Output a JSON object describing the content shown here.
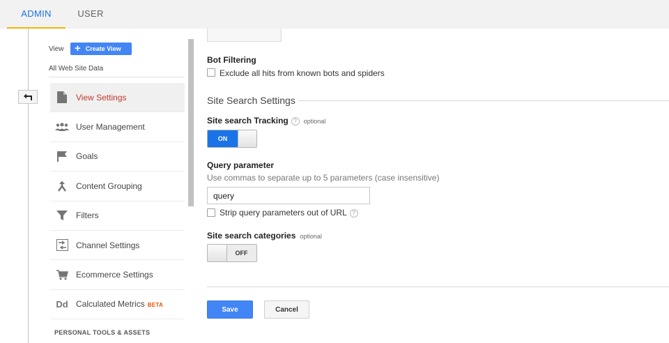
{
  "tabs": [
    {
      "label": "ADMIN",
      "active": true
    },
    {
      "label": "USER",
      "active": false
    }
  ],
  "sidebar": {
    "view_label": "View",
    "create_view_label": "Create View",
    "view_name": "All Web Site Data",
    "items": [
      {
        "label": "View Settings",
        "icon": "document-icon",
        "active": true
      },
      {
        "label": "User Management",
        "icon": "people-icon"
      },
      {
        "label": "Goals",
        "icon": "flag-icon"
      },
      {
        "label": "Content Grouping",
        "icon": "merge-icon"
      },
      {
        "label": "Filters",
        "icon": "filter-icon"
      },
      {
        "label": "Channel Settings",
        "icon": "channel-settings-icon"
      },
      {
        "label": "Ecommerce Settings",
        "icon": "cart-icon"
      },
      {
        "label": "Calculated Metrics",
        "badge": "BETA",
        "icon": "dd-icon"
      }
    ],
    "section_header": "PERSONAL TOOLS & ASSETS"
  },
  "settings": {
    "bot_filtering_title": "Bot Filtering",
    "bot_filtering_checkbox": "Exclude all hits from known bots and spiders",
    "site_search_section": "Site Search Settings",
    "site_search_tracking_label": "Site search Tracking",
    "optional_label": "optional",
    "help_glyph": "?",
    "tracking_toggle": "ON",
    "query_parameter_label": "Query parameter",
    "query_parameter_hint": "Use commas to separate up to 5 parameters (case insensitive)",
    "query_parameter_value": "query",
    "strip_query_label": "Strip query parameters out of URL",
    "site_search_categories_label": "Site search categories",
    "categories_toggle": "OFF"
  },
  "actions": {
    "save_label": "Save",
    "cancel_label": "Cancel"
  },
  "colors": {
    "accent_blue": "#1a73e8",
    "button_blue": "#4285f4",
    "active_item_red": "#c0392b",
    "tab_underline": "#f4b400"
  }
}
